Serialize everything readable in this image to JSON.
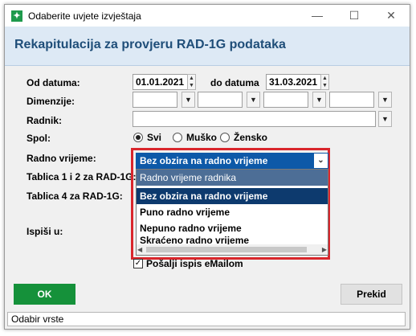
{
  "window": {
    "title": "Odaberite uvjete izvještaja",
    "minimize": "—",
    "maximize": "☐",
    "close": "✕"
  },
  "header": {
    "title": "Rekapitulacija za provjeru RAD-1G podataka"
  },
  "form": {
    "od_datuma_label": "Od datuma:",
    "od_datuma_value": "01.01.2021",
    "do_datuma_label": "do datuma",
    "do_datuma_value": "31.03.2021",
    "dimenzije_label": "Dimenzije:",
    "radnik_label": "Radnik:",
    "spol_label": "Spol:",
    "spol_options": [
      "Svi",
      "Muško",
      "Žensko"
    ],
    "radno_vrijeme_label": "Radno vrijeme:",
    "tablica12_label": "Tablica 1 i 2 za RAD-1G:",
    "tablica4_label": "Tablica 4 za RAD-1G:",
    "ispisi_label": "Ispiši u:",
    "email_checkbox_label": "Pošalji ispis eMailom",
    "email_checked": true
  },
  "radno_vrijeme": {
    "selected": "Bez obzira na radno vrijeme",
    "dropdown_header": "Radno vrijeme radnika",
    "options": [
      "Bez obzira na radno vrijeme",
      "Puno radno vrijeme",
      "Nepuno radno vrijeme",
      "Skraćeno radno vrijeme"
    ]
  },
  "buttons": {
    "ok": "OK",
    "prekid": "Prekid"
  },
  "status": "Odabir vrste",
  "colors": {
    "accent": "#15913a",
    "header_text": "#1f4e79",
    "highlight_border": "#d9262c",
    "selection": "#0d59a8"
  }
}
